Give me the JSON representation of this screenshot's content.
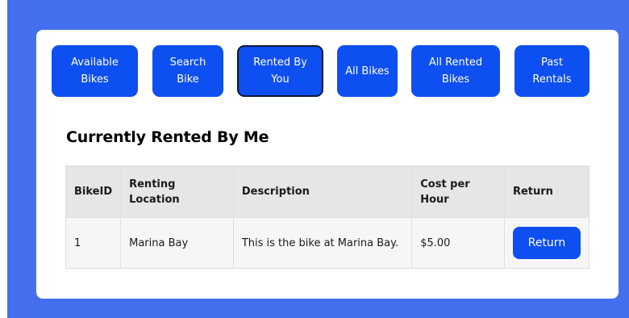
{
  "nav": {
    "available_bikes": "Available Bikes",
    "search_bike": "Search Bike",
    "rented_by_you": "Rented By You",
    "all_bikes": "All Bikes",
    "all_rented_bikes": "All Rented Bikes",
    "past_rentals": "Past Rentals"
  },
  "heading": "Currently Rented By Me",
  "table": {
    "headers": [
      "BikeID",
      "Renting Location",
      "Description",
      "Cost per Hour",
      "Return"
    ],
    "rows": [
      {
        "bike_id": "1",
        "location": "Marina Bay",
        "description": "This is the bike at Marina Bay.",
        "cost": "$5.00",
        "return_label": "Return"
      }
    ]
  },
  "colors": {
    "frame_bg": "#4470f0",
    "button_bg": "#0d4ff0",
    "active_border": "#0a1a3a"
  }
}
